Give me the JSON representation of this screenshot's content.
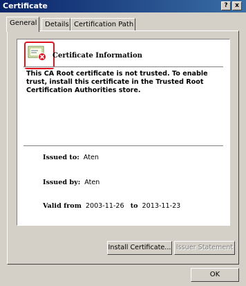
{
  "window": {
    "title": "Certificate",
    "help_button": "?",
    "close_button": "x"
  },
  "tabs": [
    {
      "label": "General",
      "active": true
    },
    {
      "label": "Details",
      "active": false
    },
    {
      "label": "Certification Path",
      "active": false
    }
  ],
  "cert": {
    "heading": "Certificate Information",
    "warning": "This CA Root certificate is not trusted. To enable trust, install this certificate in the Trusted Root Certification Authorities store.",
    "issued_to_label": "Issued to:",
    "issued_to_value": "Aten",
    "issued_by_label": "Issued by:",
    "issued_by_value": "Aten",
    "valid_from_label": "Valid from",
    "valid_from_value": "2003-11-26",
    "valid_to_label": "to",
    "valid_to_value": "2013-11-23"
  },
  "buttons": {
    "install": "Install Certificate...",
    "issuer_statement": "Issuer Statement",
    "ok": "OK"
  },
  "icons": {
    "certificate": "certificate-error-icon",
    "highlight_color": "#e0141e"
  }
}
